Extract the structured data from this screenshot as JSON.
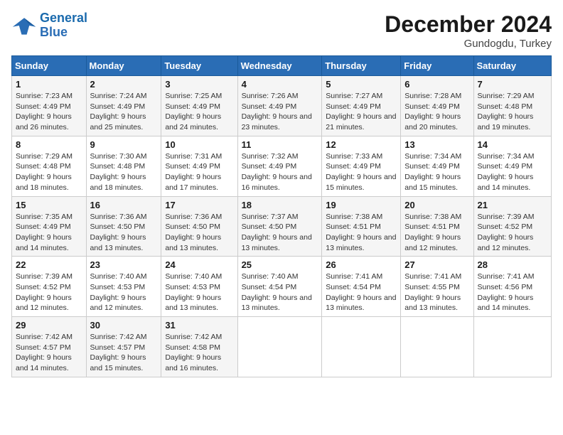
{
  "header": {
    "logo_line1": "General",
    "logo_line2": "Blue",
    "month_title": "December 2024",
    "location": "Gundogdu, Turkey"
  },
  "weekdays": [
    "Sunday",
    "Monday",
    "Tuesday",
    "Wednesday",
    "Thursday",
    "Friday",
    "Saturday"
  ],
  "weeks": [
    [
      {
        "day": "1",
        "sunrise": "7:23 AM",
        "sunset": "4:49 PM",
        "daylight": "9 hours and 26 minutes."
      },
      {
        "day": "2",
        "sunrise": "7:24 AM",
        "sunset": "4:49 PM",
        "daylight": "9 hours and 25 minutes."
      },
      {
        "day": "3",
        "sunrise": "7:25 AM",
        "sunset": "4:49 PM",
        "daylight": "9 hours and 24 minutes."
      },
      {
        "day": "4",
        "sunrise": "7:26 AM",
        "sunset": "4:49 PM",
        "daylight": "9 hours and 23 minutes."
      },
      {
        "day": "5",
        "sunrise": "7:27 AM",
        "sunset": "4:49 PM",
        "daylight": "9 hours and 21 minutes."
      },
      {
        "day": "6",
        "sunrise": "7:28 AM",
        "sunset": "4:49 PM",
        "daylight": "9 hours and 20 minutes."
      },
      {
        "day": "7",
        "sunrise": "7:29 AM",
        "sunset": "4:48 PM",
        "daylight": "9 hours and 19 minutes."
      }
    ],
    [
      {
        "day": "8",
        "sunrise": "7:29 AM",
        "sunset": "4:48 PM",
        "daylight": "9 hours and 18 minutes."
      },
      {
        "day": "9",
        "sunrise": "7:30 AM",
        "sunset": "4:48 PM",
        "daylight": "9 hours and 18 minutes."
      },
      {
        "day": "10",
        "sunrise": "7:31 AM",
        "sunset": "4:49 PM",
        "daylight": "9 hours and 17 minutes."
      },
      {
        "day": "11",
        "sunrise": "7:32 AM",
        "sunset": "4:49 PM",
        "daylight": "9 hours and 16 minutes."
      },
      {
        "day": "12",
        "sunrise": "7:33 AM",
        "sunset": "4:49 PM",
        "daylight": "9 hours and 15 minutes."
      },
      {
        "day": "13",
        "sunrise": "7:34 AM",
        "sunset": "4:49 PM",
        "daylight": "9 hours and 15 minutes."
      },
      {
        "day": "14",
        "sunrise": "7:34 AM",
        "sunset": "4:49 PM",
        "daylight": "9 hours and 14 minutes."
      }
    ],
    [
      {
        "day": "15",
        "sunrise": "7:35 AM",
        "sunset": "4:49 PM",
        "daylight": "9 hours and 14 minutes."
      },
      {
        "day": "16",
        "sunrise": "7:36 AM",
        "sunset": "4:50 PM",
        "daylight": "9 hours and 13 minutes."
      },
      {
        "day": "17",
        "sunrise": "7:36 AM",
        "sunset": "4:50 PM",
        "daylight": "9 hours and 13 minutes."
      },
      {
        "day": "18",
        "sunrise": "7:37 AM",
        "sunset": "4:50 PM",
        "daylight": "9 hours and 13 minutes."
      },
      {
        "day": "19",
        "sunrise": "7:38 AM",
        "sunset": "4:51 PM",
        "daylight": "9 hours and 13 minutes."
      },
      {
        "day": "20",
        "sunrise": "7:38 AM",
        "sunset": "4:51 PM",
        "daylight": "9 hours and 12 minutes."
      },
      {
        "day": "21",
        "sunrise": "7:39 AM",
        "sunset": "4:52 PM",
        "daylight": "9 hours and 12 minutes."
      }
    ],
    [
      {
        "day": "22",
        "sunrise": "7:39 AM",
        "sunset": "4:52 PM",
        "daylight": "9 hours and 12 minutes."
      },
      {
        "day": "23",
        "sunrise": "7:40 AM",
        "sunset": "4:53 PM",
        "daylight": "9 hours and 12 minutes."
      },
      {
        "day": "24",
        "sunrise": "7:40 AM",
        "sunset": "4:53 PM",
        "daylight": "9 hours and 13 minutes."
      },
      {
        "day": "25",
        "sunrise": "7:40 AM",
        "sunset": "4:54 PM",
        "daylight": "9 hours and 13 minutes."
      },
      {
        "day": "26",
        "sunrise": "7:41 AM",
        "sunset": "4:54 PM",
        "daylight": "9 hours and 13 minutes."
      },
      {
        "day": "27",
        "sunrise": "7:41 AM",
        "sunset": "4:55 PM",
        "daylight": "9 hours and 13 minutes."
      },
      {
        "day": "28",
        "sunrise": "7:41 AM",
        "sunset": "4:56 PM",
        "daylight": "9 hours and 14 minutes."
      }
    ],
    [
      {
        "day": "29",
        "sunrise": "7:42 AM",
        "sunset": "4:57 PM",
        "daylight": "9 hours and 14 minutes."
      },
      {
        "day": "30",
        "sunrise": "7:42 AM",
        "sunset": "4:57 PM",
        "daylight": "9 hours and 15 minutes."
      },
      {
        "day": "31",
        "sunrise": "7:42 AM",
        "sunset": "4:58 PM",
        "daylight": "9 hours and 16 minutes."
      },
      null,
      null,
      null,
      null
    ]
  ]
}
